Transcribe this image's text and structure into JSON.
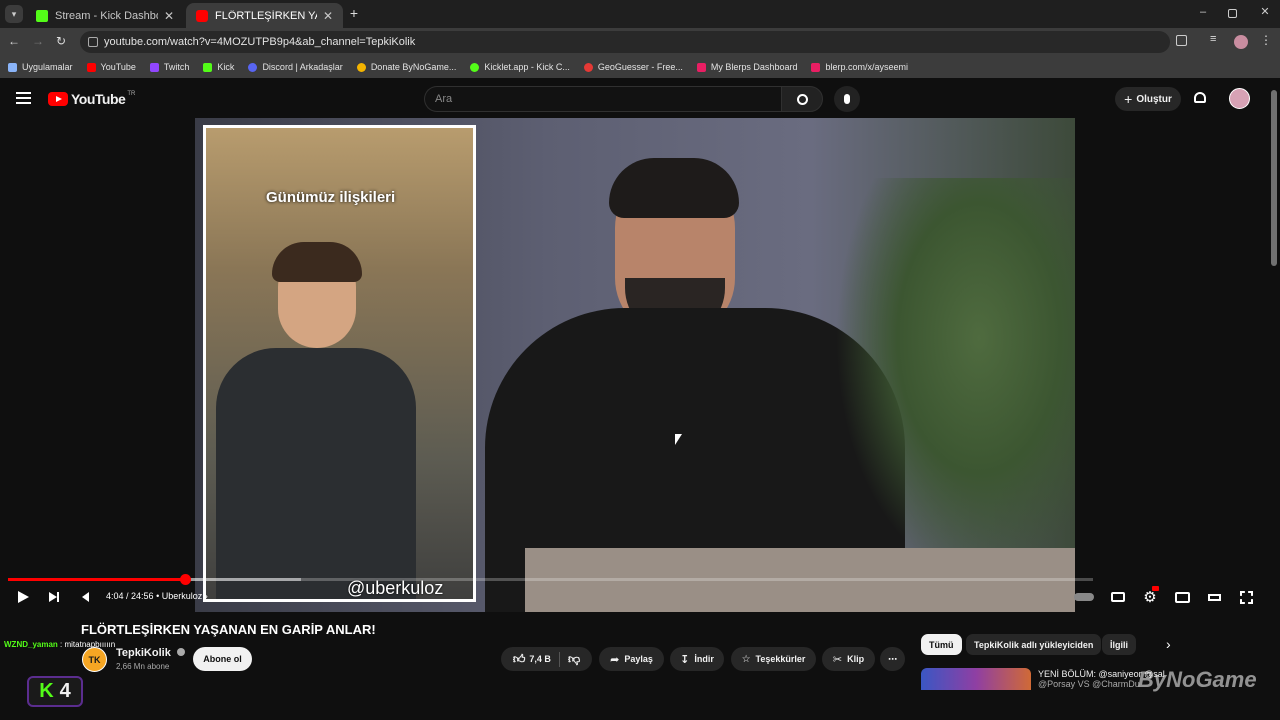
{
  "browser": {
    "tabs": [
      {
        "title": "Stream - Kick Dashboard",
        "color": "#53fc18"
      },
      {
        "title": "FLÖRTLEŞİRKEN YAŞANAN EN",
        "color": "#ff0000"
      }
    ],
    "url": "youtube.com/watch?v=4MOZUTPB9p4&ab_channel=TepkiKolik",
    "bookmarks": [
      {
        "label": "Uygulamalar",
        "color": "#8ab4f8"
      },
      {
        "label": "YouTube",
        "color": "#ff0000"
      },
      {
        "label": "Twitch",
        "color": "#9146ff"
      },
      {
        "label": "Kick",
        "color": "#53fc18"
      },
      {
        "label": "Discord | Arkadaşlar",
        "color": "#5865f2"
      },
      {
        "label": "Donate ByNoGame...",
        "color": "#f4b400"
      },
      {
        "label": "Kicklet.app - Kick C...",
        "color": "#53fc18"
      },
      {
        "label": "GeoGuesser - Free...",
        "color": "#e53935"
      },
      {
        "label": "My Blerps Dashboard",
        "color": "#e91e63"
      },
      {
        "label": "blerp.com/x/ayseemi",
        "color": "#e91e63"
      }
    ]
  },
  "youtube": {
    "logo": "YouTube",
    "region": "TR",
    "search_placeholder": "Ara",
    "create_label": "Oluştur"
  },
  "video": {
    "caption": "Günümüz ilişkileri",
    "handle": "@uberkuloz",
    "time": "4:04 / 24:56",
    "chapter": "Uberkuloz",
    "progress_fraction": 0.163,
    "buffer_fraction": 0.27,
    "title": "FLÖRTLEŞİRKEN YAŞANAN EN GARİP ANLAR!"
  },
  "chat": {
    "user": "WZND_yaman",
    "message": ": mitatnapbııııın"
  },
  "channel": {
    "avatar": "TK",
    "name": "TepkiKolik",
    "subscribers": "2,66 Mn abone",
    "subscribe_label": "Abone ol"
  },
  "actions": {
    "likes": "7,4 B",
    "share": "Paylaş",
    "download": "İndir",
    "thanks": "Teşekkürler",
    "clip": "Klip"
  },
  "chips": [
    "Tümü",
    "TepkiKolik adlı yükleyiciden",
    "İlgili"
  ],
  "recommendation": {
    "line1": "YENİ BÖLÜM: @saniyeor @sal",
    "line2": "@Porsay VS @CharmDu"
  },
  "overlay": {
    "k_count": "4",
    "watermark": "ByNoGame"
  },
  "colors": {
    "youtube_red": "#ff0000",
    "kick_green": "#53fc18"
  }
}
